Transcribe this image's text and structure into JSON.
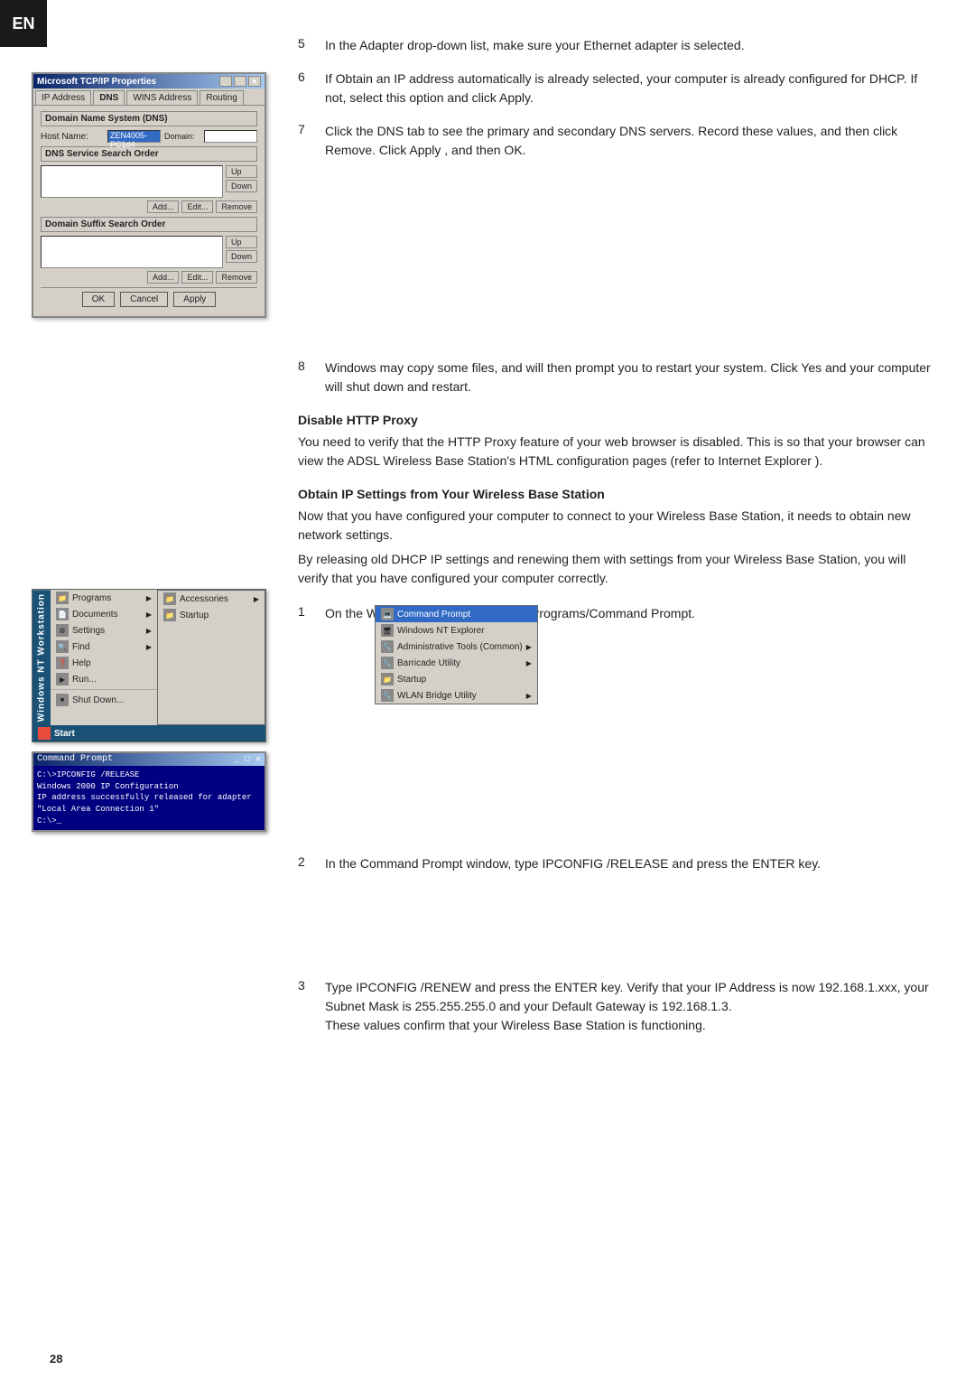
{
  "en_badge": "EN",
  "page_number": "28",
  "dialog": {
    "title": "Microsoft TCP/IP Properties",
    "tabs": [
      "IP Address",
      "DNS",
      "WINS Address",
      "Routing"
    ],
    "active_tab": "DNS",
    "section1_label": "Domain Name System (DNS)",
    "host_name_label": "Host Name:",
    "host_name_value": "ZEN4005-PC1d4",
    "domain_label": "Domain:",
    "dns_search_order_label": "DNS Service Search Order",
    "up_btn": "Up",
    "down_btn": "Down",
    "add_btn1": "Add...",
    "edit_btn1": "Edit...",
    "remove_btn1": "Remove",
    "domain_suffix_label": "Domain Suffix Search Order",
    "up_btn2": "Up",
    "down_btn2": "Down",
    "add_btn2": "Add...",
    "edit_btn2": "Edit...",
    "remove_btn2": "Remove",
    "ok_btn": "OK",
    "cancel_btn": "Cancel",
    "apply_btn": "Apply"
  },
  "start_menu": {
    "sidebar_text": "Windows NT Workstation",
    "items": [
      {
        "label": "Programs",
        "icon": "folder",
        "has_arrow": true
      },
      {
        "label": "Documents",
        "icon": "doc",
        "has_arrow": true
      },
      {
        "label": "Settings",
        "icon": "gear",
        "has_arrow": true
      },
      {
        "label": "Find",
        "icon": "find",
        "has_arrow": true
      },
      {
        "label": "Help",
        "icon": "help",
        "has_arrow": false
      },
      {
        "label": "Run...",
        "icon": "run",
        "has_arrow": false
      },
      {
        "label": "Shut Down...",
        "icon": "shutdown",
        "has_arrow": false
      }
    ],
    "start_label": "Start",
    "submenu_programs": {
      "label": "Accessories",
      "items": [
        "Accessories",
        "Startup"
      ]
    },
    "submenu_accessories": {
      "items": [
        {
          "label": "Command Prompt",
          "highlight": true
        },
        {
          "label": "Windows NT Explorer"
        },
        {
          "label": "Administrative Tools (Common)",
          "has_arrow": true
        },
        {
          "label": "Barricade Utility",
          "has_arrow": true
        },
        {
          "label": "Startup"
        },
        {
          "label": "WLAN Bridge Utility",
          "has_arrow": true
        }
      ]
    }
  },
  "cmd_window": {
    "title": "Command Prompt",
    "lines": [
      "C:\\>IPCONFIG /RELEASE",
      "Windows 2000 IP Configuration",
      "IP address successfully released for adapter \"Local Area Connection 1\"",
      "C:\\>_"
    ]
  },
  "steps": [
    {
      "num": "5",
      "text": "In the Adapter drop-down list, make sure your Ethernet adapter is selected."
    },
    {
      "num": "6",
      "text": "If Obtain an IP address automatically  is already selected, your computer is already configured for DHCP. If not, select this option and click  Apply."
    },
    {
      "num": "7",
      "text": "Click the DNS tab to see the primary and secondary DNS servers. Record these values, and then click  Remove. Click  Apply , and then  OK."
    },
    {
      "num": "8",
      "text": "Windows may copy some files, and will then prompt you to restart your system. Click Yes and your computer will shut down and restart."
    }
  ],
  "sections": [
    {
      "heading": "Disable HTTP Proxy",
      "body": "You need to verify that the  HTTP Proxy  feature of your web browser is disabled. This is so that your browser can view the ADSL Wireless Base Station's HTML configuration pages (refer to  Internet Explorer )."
    },
    {
      "heading": "Obtain IP Settings from Your Wireless Base Station",
      "body1": "Now that you have configured your computer to connect to your Wireless Base Station, it needs to obtain new network settings.",
      "body2": "By releasing old DHCP IP settings and renewing them with settings from your Wireless Base Station, you will verify that you have configured your computer correctly."
    }
  ],
  "obtain_steps": [
    {
      "num": "1",
      "text": "On the Windows desktop, click Start/Programs/Command Prompt."
    },
    {
      "num": "2",
      "text": "In the Command Prompt window, type  IPCONFIG /RELEASE and press the ENTER key."
    },
    {
      "num": "3",
      "text": "Type  IPCONFIG /RENEW  and press the ENTER key. Verify that your IP Address is now 192.168.1.xxx, your Subnet Mask is 255.255.255.0 and your Default Gateway is 192.168.1.3.\nThese values confirm that your Wireless Base Station is functioning."
    }
  ]
}
